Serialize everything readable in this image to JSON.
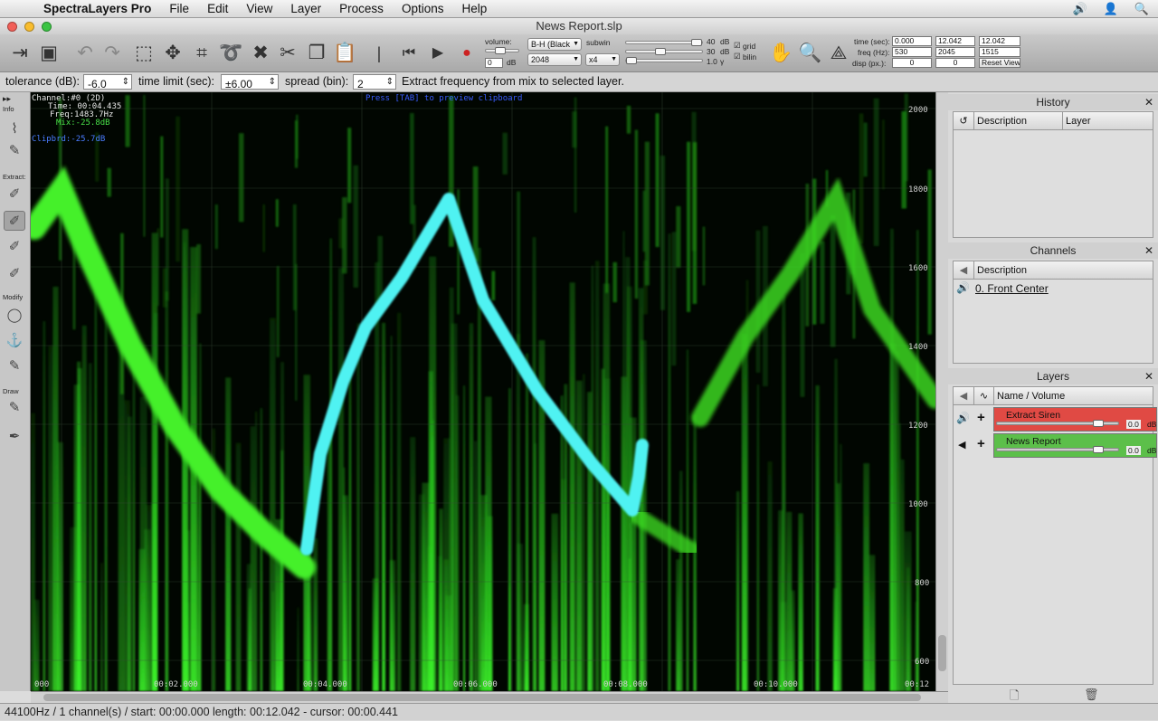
{
  "menubar": {
    "app": "SpectraLayers Pro",
    "items": [
      "File",
      "Edit",
      "View",
      "Layer",
      "Process",
      "Options",
      "Help"
    ]
  },
  "window": {
    "title": "News Report.slp"
  },
  "toolbar": {
    "volume_label": "volume:",
    "volume_value": "0",
    "volume_unit": "dB",
    "colormap": "B-H (Black",
    "fft_size": "2048",
    "subwin_label": "subwin",
    "subwin_value": "x4",
    "db_top": "40",
    "db_mid": "30",
    "db_bottom": "1.0",
    "db_unit": "dB",
    "gamma_unit": "γ",
    "grid_label": "grid",
    "bilin_label": "bilin",
    "time_label": "time (sec):",
    "time_start": "0.000",
    "time_end": "12.042",
    "time_len": "12.042",
    "freq_label": "freq (Hz):",
    "freq_start": "530",
    "freq_end": "2045",
    "freq_len": "1515",
    "disp_label": "disp (px.):",
    "disp_x": "0",
    "disp_y": "0",
    "reset_view": "Reset View"
  },
  "options": {
    "tolerance_label": "tolerance (dB):",
    "tolerance_value": "-6.0",
    "time_limit_label": "time limit (sec):",
    "time_limit_value": "±6.00",
    "spread_label": "spread (bin):",
    "spread_value": "2",
    "hint": "Extract frequency from mix to selected layer."
  },
  "tools": {
    "info_label": "Info",
    "extract_label": "Extract:",
    "modify_label": "Modify",
    "draw_label": "Draw"
  },
  "overlay": {
    "channel": "Channel:#0 (2D)",
    "time": "Time: 00:04.435",
    "freq": "Freq:1483.7Hz",
    "mix": "Mix:-25.8dB",
    "clipbrd": "Clipbrd:-25.7dB",
    "press": "Press [TAB] to preview clipboard"
  },
  "freq_ticks": [
    "2000",
    "1800",
    "1600",
    "1400",
    "1200",
    "1000",
    "800",
    "600"
  ],
  "time_ticks": [
    "000",
    "00:02.000",
    "00:04.000",
    "00:06.000",
    "00:08.000",
    "00:10.000",
    "00:12"
  ],
  "history": {
    "title": "History",
    "col_description": "Description",
    "col_layer": "Layer"
  },
  "channels": {
    "title": "Channels",
    "col_description": "Description",
    "items": [
      "0. Front Center"
    ]
  },
  "layers": {
    "title": "Layers",
    "col_name": "Name / Volume",
    "items": [
      {
        "name": "Extract Siren",
        "volume": "0.0",
        "unit": "dB",
        "color": "#e04a44"
      },
      {
        "name": "News Report",
        "volume": "0.0",
        "unit": "dB",
        "color": "#5cbf4a"
      }
    ]
  },
  "status": "44100Hz / 1 channel(s) / start: 00:00.000 length:  00:12.042 - cursor:  00:00.441"
}
